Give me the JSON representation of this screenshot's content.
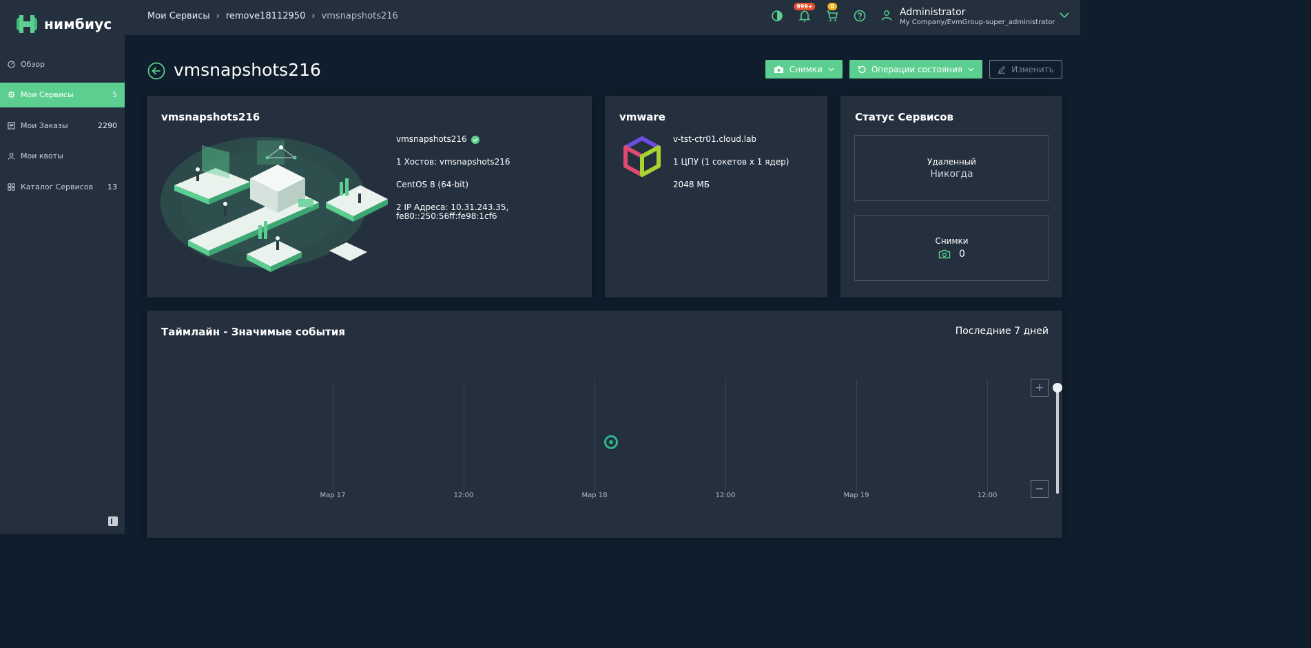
{
  "brand": {
    "name": "нимбиус",
    "accent": "#5ccf90"
  },
  "sidebar": {
    "items": [
      {
        "label": "Обзор",
        "count": "",
        "icon": "dashboard-icon"
      },
      {
        "label": "Мои Сервисы",
        "count": "5",
        "icon": "gear-icon"
      },
      {
        "label": "Мои Заказы",
        "count": "2290",
        "icon": "list-icon"
      },
      {
        "label": "Мои квоты",
        "count": "",
        "icon": "user-icon"
      },
      {
        "label": "Каталог Сервисов",
        "count": "13",
        "icon": "grid-icon"
      }
    ]
  },
  "header": {
    "breadcrumb": [
      "Мои Сервисы",
      "remove18112950",
      "vmsnapshots216"
    ],
    "notifications_badge": "999+",
    "cart_badge": "0",
    "user_name": "Administrator",
    "user_org": "My Company/EvmGroup-super_administrator"
  },
  "page": {
    "title": "vmsnapshots216",
    "actions": {
      "snapshots": "Снимки",
      "state_ops": "Операции состояния",
      "edit": "Изменить"
    }
  },
  "service_card": {
    "title": "vmsnapshots216",
    "name": "vmsnapshots216",
    "hosts": "1 Хостов: vmsnapshots216",
    "os": "CentOS 8 (64-bit)",
    "ip_line1": "2 IP Адреса: 10.31.243.35,",
    "ip_line2": "fe80::250:56ff:fe98:1cf6"
  },
  "provider_card": {
    "title": "vmware",
    "host": "v-tst-ctr01.cloud.lab",
    "cpu": "1 ЦПУ (1 сокетов x 1 ядер)",
    "memory": "2048 МБ"
  },
  "status_card": {
    "title": "Статус Сервисов",
    "retired_label": "Удаленный",
    "retired_value": "Никогда",
    "snapshots_label": "Снимки",
    "snapshots_value": "0"
  },
  "timeline": {
    "title": "Таймлайн - Значимые события",
    "range": "Последние 7 дней",
    "ticks": [
      "Мар 17",
      "12:00",
      "Мар 18",
      "12:00",
      "Мар 19",
      "12:00"
    ],
    "zoom_in": "+",
    "zoom_out": "−"
  }
}
